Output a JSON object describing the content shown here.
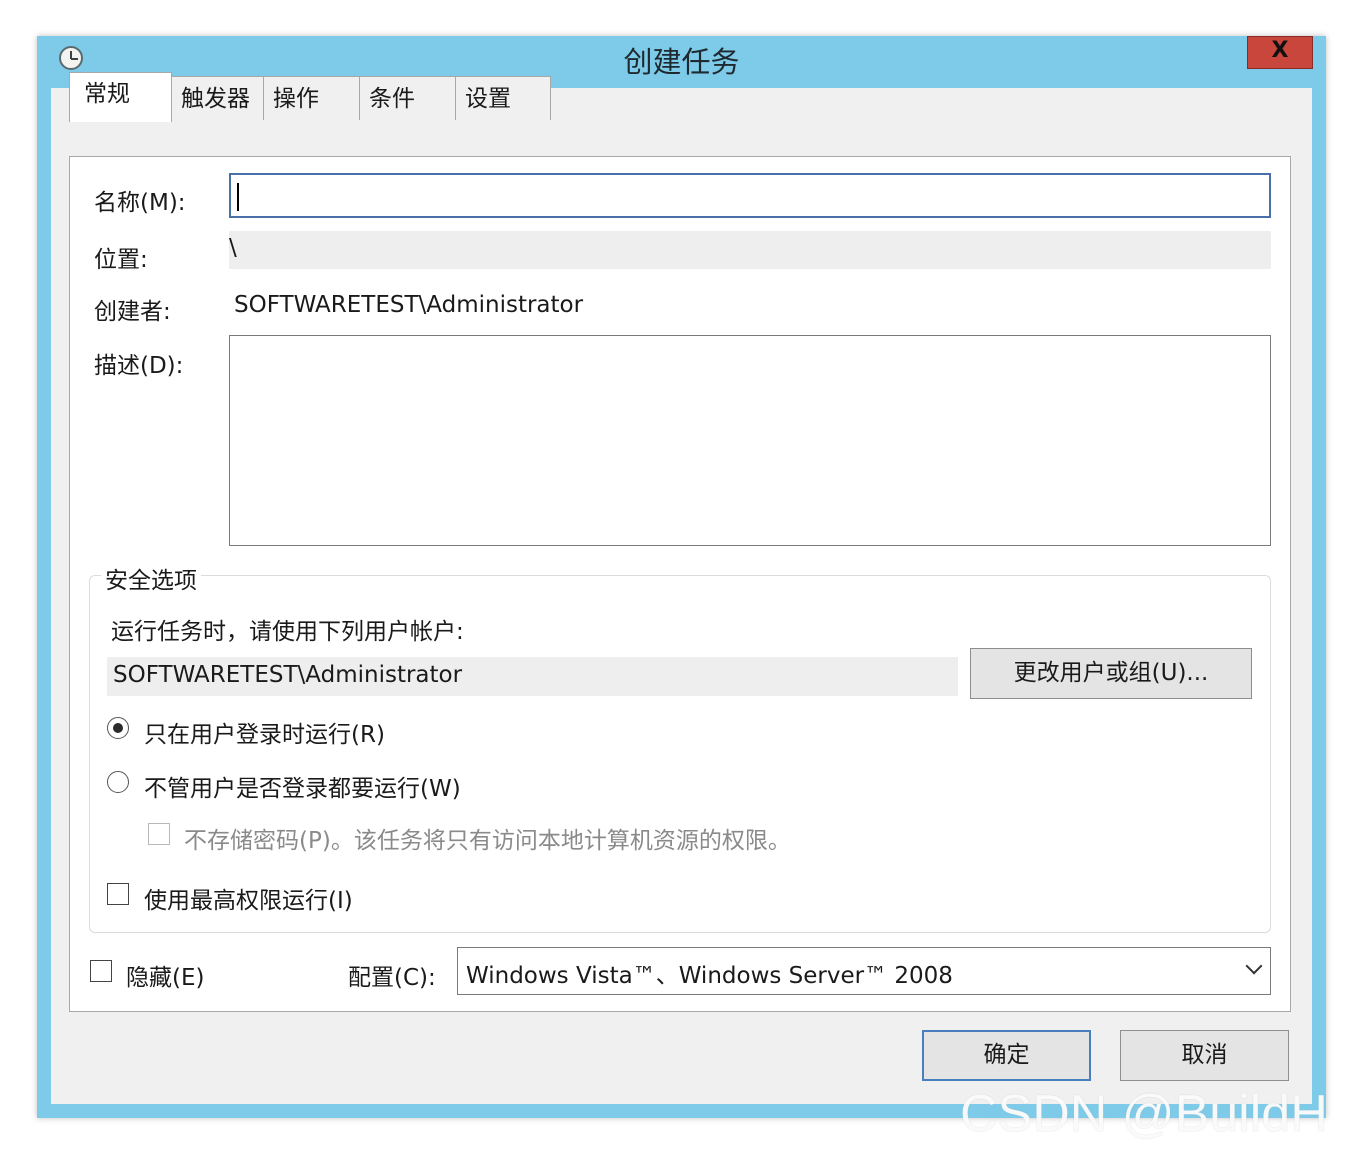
{
  "window": {
    "title": "创建任务",
    "close_label": "X"
  },
  "tabs": [
    {
      "label": "常规",
      "active": true
    },
    {
      "label": "触发器",
      "active": false
    },
    {
      "label": "操作",
      "active": false
    },
    {
      "label": "条件",
      "active": false
    },
    {
      "label": "设置",
      "active": false
    }
  ],
  "general": {
    "name_label": "名称(M):",
    "name_value": "",
    "location_label": "位置:",
    "location_value": "\\",
    "author_label": "创建者:",
    "author_value": "SOFTWARETEST\\Administrator",
    "description_label": "描述(D):",
    "description_value": ""
  },
  "security": {
    "legend": "安全选项",
    "run_as_prompt": "运行任务时，请使用下列用户帐户:",
    "user_account": "SOFTWARETEST\\Administrator",
    "change_user_button": "更改用户或组(U)...",
    "radio_logged_on": "只在用户登录时运行(R)",
    "radio_whether_logged_on": "不管用户是否登录都要运行(W)",
    "no_store_password": "不存储密码(P)。该任务将只有访问本地计算机资源的权限。",
    "highest_privileges": "使用最高权限运行(I)"
  },
  "footer": {
    "hidden_label": "隐藏(E)",
    "configure_label": "配置(C):",
    "configure_value": "Windows Vista™、Windows Server™ 2008",
    "ok_button": "确定",
    "cancel_button": "取消"
  },
  "watermark": "CSDN @BuildH"
}
